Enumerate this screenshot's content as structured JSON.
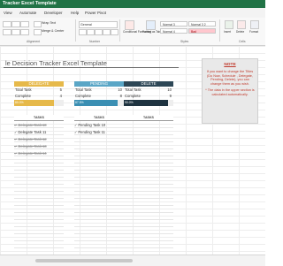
{
  "window": {
    "title": "Tracker Excel Template"
  },
  "menu": [
    "View",
    "Automate",
    "Developer",
    "Help",
    "Power Pivot"
  ],
  "ribbon": {
    "wrap_text": "Wrap Text",
    "merge_center": "Merge & Center",
    "number_format": "General",
    "conditional_formatting": "Conditional Formatting",
    "format_as_table": "Format as Table",
    "styles": [
      "Normal 3",
      "Normal 3 2",
      "Normal 4",
      "Bad"
    ],
    "cells": [
      "Insert",
      "Delete",
      "Format"
    ],
    "groups": {
      "alignment": "Alignment",
      "number": "Number",
      "styles": "Styles",
      "cells": "Cells"
    }
  },
  "sheet": {
    "title": "le Decision Tracker Excel Template",
    "columns": [
      {
        "header": "DELEGATE",
        "color": "#e6b94a",
        "total_label": "Total Task",
        "total": "5",
        "complete_label": "Complete",
        "complete": "4",
        "progress_text": "80.0%",
        "progress": 0.8,
        "fill_color": "#e6b94a",
        "tasks_label": "TASKS",
        "tasks": [
          {
            "text": "Delegate Task 10",
            "done": true
          },
          {
            "text": "Delegate Task 11",
            "done": false
          },
          {
            "text": "Delegate Task 12",
            "done": true
          },
          {
            "text": "Delegate Task 13",
            "done": true
          },
          {
            "text": "Delegate Task 14",
            "done": true
          }
        ]
      },
      {
        "header": "PENDING",
        "color": "#5aa6c6",
        "total_label": "Total Task",
        "total": "10",
        "complete_label": "Complete",
        "complete": "8",
        "progress_text": "87.5%",
        "progress": 0.875,
        "fill_color": "#3b8fb3",
        "tasks_label": "TASKS",
        "tasks": [
          {
            "text": "Pending Task 10",
            "done": false
          },
          {
            "text": "Pending Task 11",
            "done": false
          }
        ]
      },
      {
        "header": "DELETE",
        "color": "#2d4756",
        "total_label": "Total Task",
        "total": "10",
        "complete_label": "Complete",
        "complete": "9",
        "progress_text": "90.0%",
        "progress": 0.9,
        "fill_color": "#1e3340",
        "tasks_label": "TASKS",
        "tasks": []
      }
    ],
    "note": {
      "title": "NOTE",
      "text1": "If you want to change the Titles (Do Now, Schedule , Delegate, Pending, Delete), you can change them as you wish.",
      "text2": "* The data in the upper section is calculated automatically."
    }
  }
}
